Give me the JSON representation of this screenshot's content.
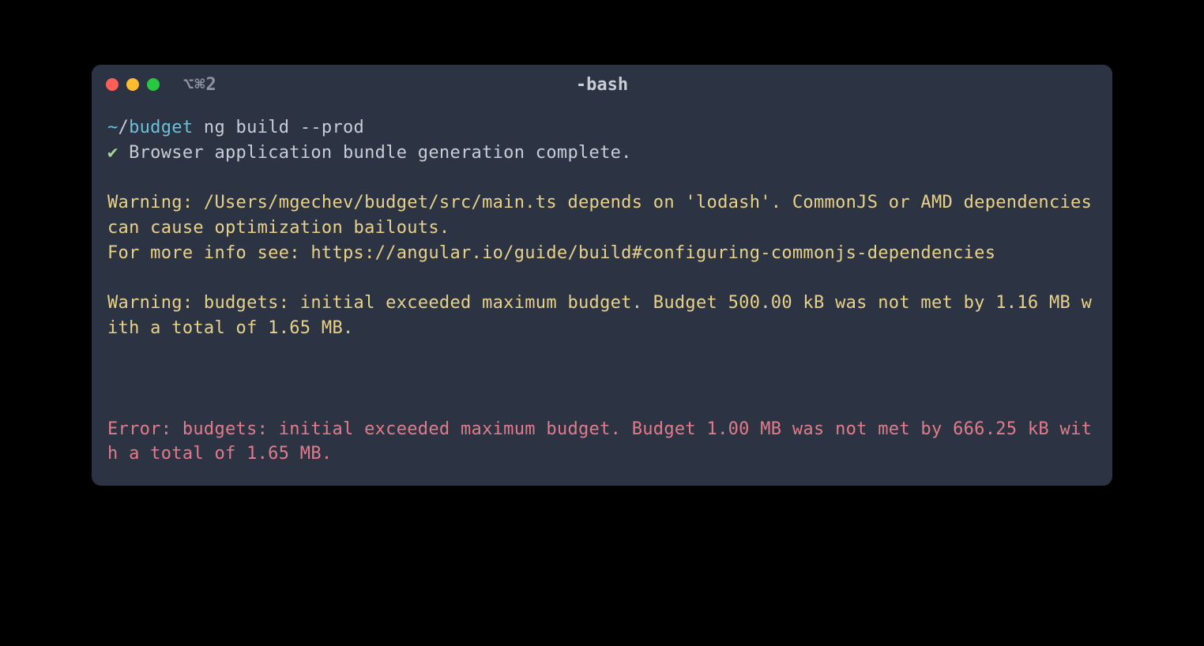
{
  "titlebar": {
    "tab_indicator": "⌥⌘2",
    "title": "-bash"
  },
  "prompt": {
    "tilde": "~",
    "slash": "/",
    "dir": "budget",
    "command": " ng build --prod"
  },
  "output": {
    "check": "✔",
    "complete": " Browser application bundle generation complete.",
    "warning1": "Warning: /Users/mgechev/budget/src/main.ts depends on 'lodash'. CommonJS or AMD dependencies can cause optimization bailouts.",
    "warning1_extra": "For more info see: https://angular.io/guide/build#configuring-commonjs-dependencies",
    "warning2": "Warning: budgets: initial exceeded maximum budget. Budget 500.00 kB was not met by 1.16 MB with a total of 1.65 MB.",
    "error1": "Error: budgets: initial exceeded maximum budget. Budget 1.00 MB was not met by 666.25 kB with a total of 1.65 MB."
  }
}
